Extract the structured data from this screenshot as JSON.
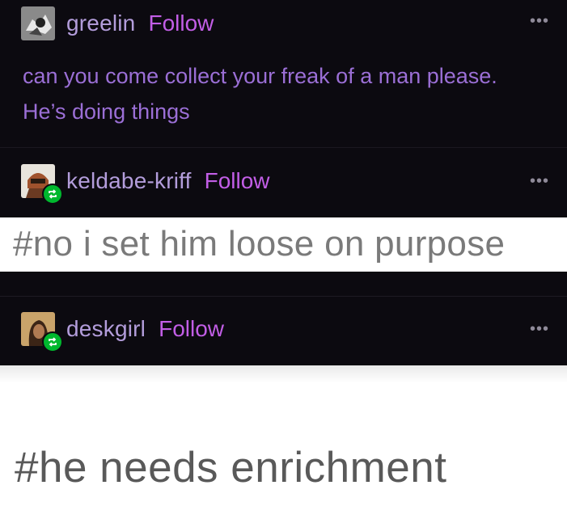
{
  "posts": [
    {
      "username": "greelin",
      "follow_label": "Follow",
      "more_label": "•••",
      "avatar_icon": "greelin-avatar",
      "body": [
        "can you come collect your freak of a man please.",
        "He’s doing things"
      ]
    },
    {
      "username": "keldabe-kriff",
      "follow_label": "Follow",
      "more_label": "•••",
      "avatar_icon": "keldabe-kriff-avatar",
      "reblog_icon": "reblog-icon",
      "tag": "#no i set him loose on purpose"
    },
    {
      "username": "deskgirl",
      "follow_label": "Follow",
      "more_label": "•••",
      "avatar_icon": "deskgirl-avatar",
      "reblog_icon": "reblog-icon",
      "tag": "#he needs enrichment"
    }
  ],
  "colors": {
    "background": "#0c0a10",
    "username": "#b39ddb",
    "follow": "#c25ee6",
    "body_text": "#9b6fd6",
    "reblog_badge": "#00b82e",
    "tag_text": "#7a7a7a"
  }
}
